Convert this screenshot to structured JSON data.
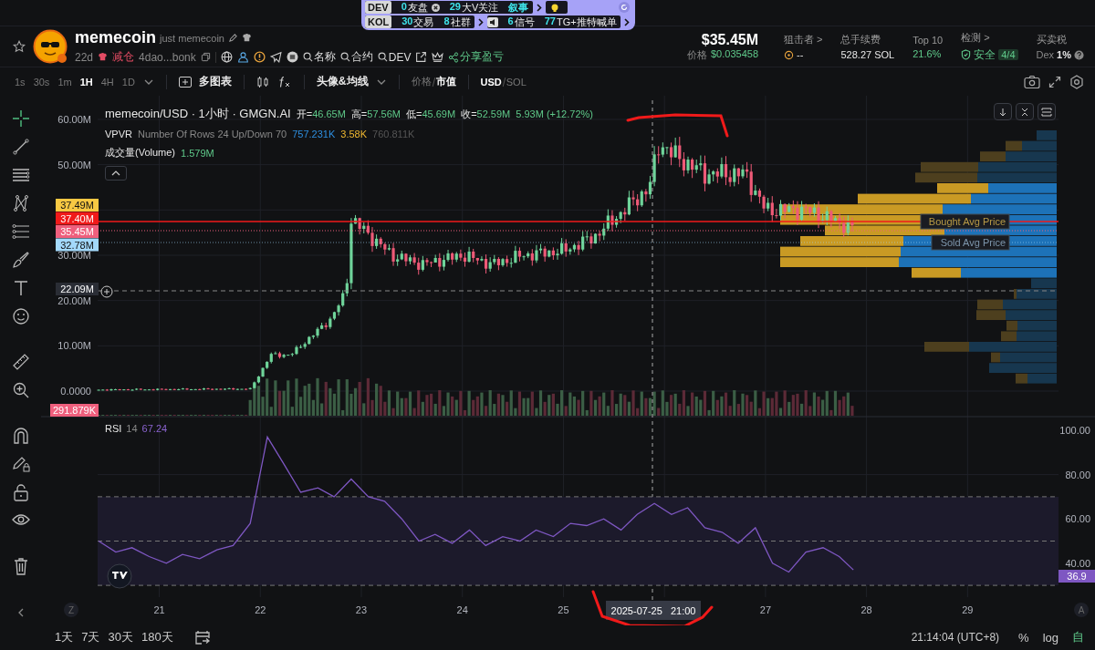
{
  "signal_banner": {
    "rows": [
      {
        "groups": [
          {
            "tag": "DEV",
            "stats": [
              {
                "count": "0",
                "name": "友盘"
              },
              {
                "count": "29",
                "name": "大V关注"
              },
              {
                "count": "叙事"
              }
            ]
          },
          {
            "kind": "bulb"
          }
        ]
      },
      {
        "groups": [
          {
            "tag": "KOL",
            "stats": [
              {
                "count": "30",
                "name": "交易"
              },
              {
                "count": "8",
                "name": "社群"
              }
            ]
          },
          {
            "kind": "signal",
            "stats": [
              {
                "count": "6",
                "name": "信号"
              },
              {
                "count": "77",
                "name": "TG+推特喊单"
              }
            ]
          }
        ]
      }
    ]
  },
  "token": {
    "name": "memecoin",
    "alias": "just memecoin",
    "age": "22d",
    "tag": "减仓",
    "address": "4dao...bonk",
    "searches": [
      "名称",
      "合约",
      "DEV"
    ],
    "share": "分享盈亏"
  },
  "market": {
    "market_cap": "$35.45M",
    "price_label": "价格",
    "price": "$0.035458"
  },
  "stats": [
    {
      "kind": "sniper",
      "label": "狙击者 >",
      "value": "--"
    },
    {
      "kind": "plain",
      "label": "总手续费",
      "value": "528.27 SOL"
    },
    {
      "kind": "percent",
      "label": "Top 10",
      "value": "21.6%"
    },
    {
      "kind": "check",
      "label": "检测 >",
      "value": "安全",
      "badge": "4/4"
    },
    {
      "kind": "tax",
      "label": "买卖税",
      "value": "Dex",
      "strong": "1%"
    }
  ],
  "toolbar": {
    "intervals": [
      {
        "label": "1s",
        "selected": false
      },
      {
        "label": "30s",
        "selected": false
      },
      {
        "label": "1m",
        "selected": false
      },
      {
        "label": "1H",
        "selected": true
      },
      {
        "label": "4H",
        "selected": false
      },
      {
        "label": "1D",
        "selected": false
      }
    ],
    "multi_chart": "多图表",
    "indicators": "头像&均线",
    "price_mode": [
      {
        "label": "价格",
        "selected": false
      },
      {
        "label": "市值",
        "selected": true
      }
    ],
    "currency": [
      {
        "label": "USD",
        "selected": true
      },
      {
        "label": "SOL",
        "selected": false
      }
    ]
  },
  "chart": {
    "legend": {
      "title": "memecoin/USD · 1小时 · GMGN.AI",
      "ohlc": [
        {
          "label": "开=",
          "value": "46.65M"
        },
        {
          "label": "高=",
          "value": "57.56M"
        },
        {
          "label": "低=",
          "value": "45.69M"
        },
        {
          "label": "收=",
          "value": "52.59M"
        }
      ],
      "change": "5.93M (+12.72%)"
    },
    "vpvr": {
      "label": "VPVR",
      "params": "Number Of Rows 24 Up/Down 70",
      "up": "757.231K",
      "down": "3.58K",
      "total": "760.811K"
    },
    "volume": {
      "label": "成交量(Volume)",
      "value": "1.579M"
    },
    "price_axis": [
      "60.00M",
      "50.00M",
      "30.00M",
      "20.00M",
      "10.00M",
      "0.0000"
    ],
    "price_tags": [
      {
        "text": "37.49M",
        "color": "#f7c843"
      },
      {
        "text": "37.40M",
        "color": "#f01a1a"
      },
      {
        "text": "35.45M",
        "color": "#ef5f7d"
      },
      {
        "text": "32.78M",
        "color": "#a3d9fb"
      }
    ],
    "crosshair_price": "22.09M",
    "volume_tag": "291.879K",
    "profile_labels": [
      "Bought Avg Price",
      "Sold Avg Price"
    ],
    "rsi": {
      "period": "14",
      "value": "67.24",
      "tag": "36.9",
      "chart_data": {
        "type": "line",
        "xlim": [
          20.39,
          29.9
        ],
        "ylim": [
          30,
          100
        ],
        "yticks": [
          {
            "value": 100,
            "label": "100.00"
          },
          {
            "value": 80,
            "label": "80.00"
          },
          {
            "value": 60,
            "label": "60.00"
          },
          {
            "value": 40,
            "label": "40.00"
          }
        ],
        "xticks": [
          {
            "value": 21,
            "label": "21"
          },
          {
            "value": 22,
            "label": "22"
          },
          {
            "value": 23,
            "label": "23"
          },
          {
            "value": 24,
            "label": "24"
          },
          {
            "value": 25,
            "label": "25"
          },
          {
            "value": 27,
            "label": "27"
          },
          {
            "value": 28,
            "label": "28"
          },
          {
            "value": 29,
            "label": "29"
          }
        ],
        "x": [
          20.4,
          20.57,
          20.73,
          20.9,
          21.07,
          21.23,
          21.4,
          21.57,
          21.73,
          21.9,
          22.07,
          22.23,
          22.4,
          22.57,
          22.73,
          22.9,
          23.07,
          23.23,
          23.4,
          23.57,
          23.73,
          23.9,
          24.07,
          24.23,
          24.4,
          24.57,
          24.73,
          24.9,
          25.07,
          25.23,
          25.4,
          25.57,
          25.73,
          25.9,
          26.07,
          26.23,
          26.4,
          26.57,
          26.73,
          26.9,
          27.07,
          27.23,
          27.4,
          27.57,
          27.73,
          27.87
        ],
        "series": [
          {
            "name": "RSI",
            "color": "#7e57c2",
            "values": [
              50,
              45,
              47,
              43,
              40,
              44,
              42,
              46,
              48,
              58,
              97,
              85,
              72,
              74,
              70,
              78,
              70,
              68,
              60,
              50,
              53,
              49,
              55,
              48,
              52,
              50,
              55,
              52,
              58,
              57,
              60,
              55,
              62,
              67,
              62,
              65,
              56,
              54,
              49,
              56,
              40,
              36,
              45,
              47,
              43,
              37
            ]
          }
        ]
      }
    },
    "crosshair_time": "2025-07-25   21:00",
    "left_axis_button": "Z",
    "right_axis_button": "A"
  },
  "range_buttons": [
    "1天",
    "7天",
    "30天",
    "180天"
  ],
  "clock": "21:14:04 (UTC+8)",
  "scale_buttons": [
    {
      "label": "%",
      "selected": false
    },
    {
      "label": "log",
      "selected": false
    },
    {
      "label": "自",
      "selected": true
    }
  ]
}
